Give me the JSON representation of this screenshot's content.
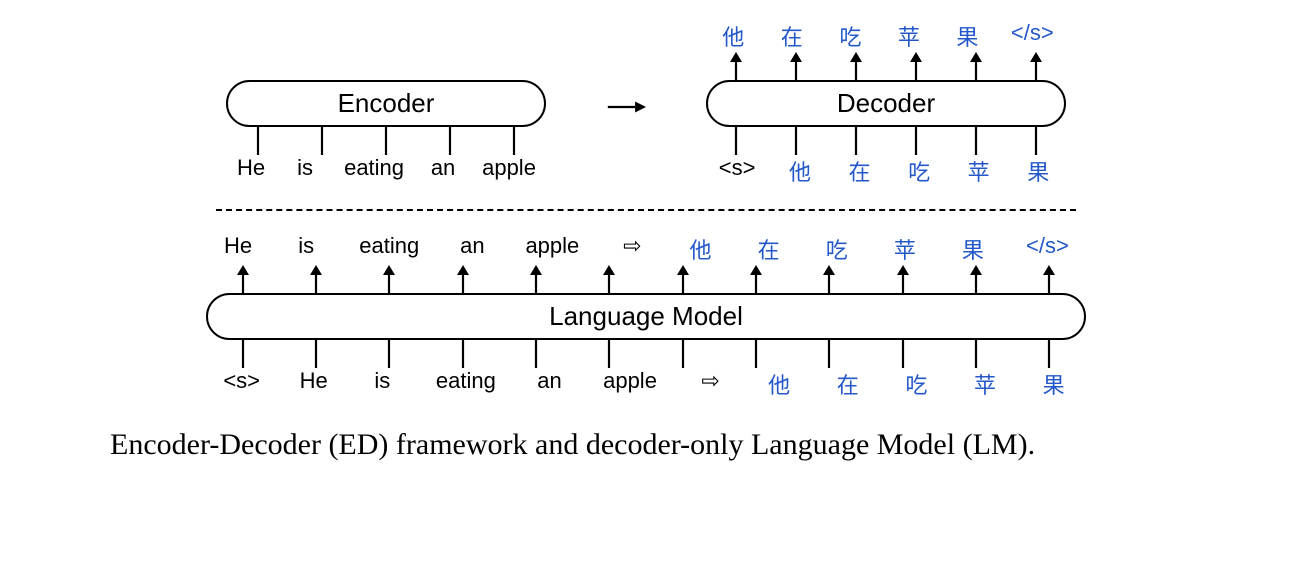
{
  "encdec": {
    "encoder_label": "Encoder",
    "decoder_label": "Decoder",
    "encoder_inputs": [
      "He",
      "is",
      "eating",
      "an",
      "apple"
    ],
    "decoder_inputs": [
      "<s>",
      "他",
      "在",
      "吃",
      "苹",
      "果"
    ],
    "decoder_outputs": [
      "他",
      "在",
      "吃",
      "苹",
      "果",
      "</s>"
    ]
  },
  "lm": {
    "label": "Language Model",
    "inputs": [
      "<s>",
      "He",
      "is",
      "eating",
      "an",
      "apple",
      "⇨",
      "他",
      "在",
      "吃",
      "苹",
      "果"
    ],
    "outputs": [
      "He",
      "is",
      "eating",
      "an",
      "apple",
      "⇨",
      "他",
      "在",
      "吃",
      "苹",
      "果",
      "</s>"
    ]
  },
  "caption": "Encoder-Decoder (ED) framework and decoder-only Language Model (LM).",
  "token_lang": {
    "他": "cn",
    "在": "cn",
    "吃": "cn",
    "苹": "cn",
    "果": "cn",
    "</s>": "cn",
    "<s>": "en",
    "He": "en",
    "is": "en",
    "eating": "en",
    "an": "en",
    "apple": "en",
    "⇨": "en"
  }
}
